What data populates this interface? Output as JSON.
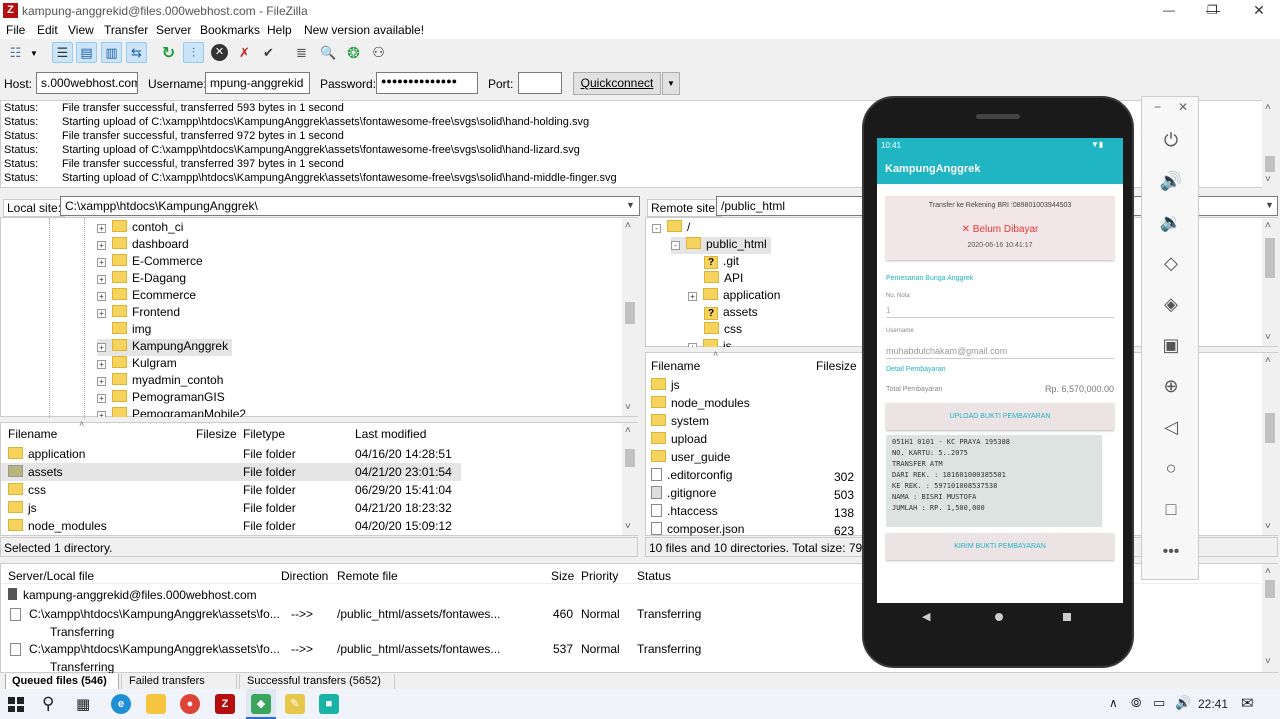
{
  "window": {
    "title": "kampung-anggrekid@files.000webhost.com - FileZilla",
    "app_icon": "Z"
  },
  "menu": [
    "File",
    "Edit",
    "View",
    "Transfer",
    "Server",
    "Bookmarks",
    "Help",
    "New version available!"
  ],
  "quickconnect": {
    "host_label": "Host:",
    "host_value": "s.000webhost.com",
    "username_label": "Username:",
    "username_value": "mpung-anggrekid",
    "password_label": "Password:",
    "password_value": "●●●●●●●●●●●●●●",
    "port_label": "Port:",
    "port_value": "",
    "button": "Quickconnect"
  },
  "log": [
    {
      "k": "Status:",
      "v": "File transfer successful, transferred 593 bytes in 1 second"
    },
    {
      "k": "Status:",
      "v": "Starting upload of C:\\xampp\\htdocs\\KampungAnggrek\\assets\\fontawesome-free\\svgs\\solid\\hand-holding.svg"
    },
    {
      "k": "Status:",
      "v": "File transfer successful, transferred 972 bytes in 1 second"
    },
    {
      "k": "Status:",
      "v": "Starting upload of C:\\xampp\\htdocs\\KampungAnggrek\\assets\\fontawesome-free\\svgs\\solid\\hand-lizard.svg"
    },
    {
      "k": "Status:",
      "v": "File transfer successful, transferred 397 bytes in 1 second"
    },
    {
      "k": "Status:",
      "v": "Starting upload of C:\\xampp\\htdocs\\KampungAnggrek\\assets\\fontawesome-free\\svgs\\solid\\hand-middle-finger.svg"
    }
  ],
  "local": {
    "site_label": "Local site:",
    "site_path": "C:\\xampp\\htdocs\\KampungAnggrek\\",
    "tree": [
      "contoh_ci",
      "dashboard",
      "E-Commerce",
      "E-Dagang",
      "Ecommerce",
      "Frontend",
      "img",
      "KampungAnggrek",
      "Kulgram",
      "myadmin_contoh",
      "PemogramanGIS",
      "PemogramanMobile2"
    ],
    "headers": {
      "name": "Filename",
      "size": "Filesize",
      "type": "Filetype",
      "modified": "Last modified"
    },
    "files": [
      {
        "name": "application",
        "type": "File folder",
        "modified": "04/16/20 14:28:51"
      },
      {
        "name": "assets",
        "type": "File folder",
        "modified": "04/21/20 23:01:54"
      },
      {
        "name": "css",
        "type": "File folder",
        "modified": "06/29/20 15:41:04"
      },
      {
        "name": "js",
        "type": "File folder",
        "modified": "04/21/20 18:23:32"
      },
      {
        "name": "node_modules",
        "type": "File folder",
        "modified": "04/20/20 15:09:12"
      }
    ],
    "status": "Selected 1 directory."
  },
  "remote": {
    "site_label": "Remote site:",
    "site_path": "/public_html",
    "tree": [
      {
        "name": "/",
        "q": false
      },
      {
        "name": "public_html",
        "q": false
      },
      {
        "name": ".git",
        "q": true
      },
      {
        "name": "API",
        "q": false
      },
      {
        "name": "application",
        "q": false
      },
      {
        "name": "assets",
        "q": true
      },
      {
        "name": "css",
        "q": false
      },
      {
        "name": "js",
        "q": false
      }
    ],
    "headers": {
      "name": "Filename",
      "size": "Filesize"
    },
    "files": [
      {
        "name": "js",
        "size": "",
        "folder": true
      },
      {
        "name": "node_modules",
        "size": "",
        "folder": true
      },
      {
        "name": "system",
        "size": "",
        "folder": true
      },
      {
        "name": "upload",
        "size": "",
        "folder": true
      },
      {
        "name": "user_guide",
        "size": "",
        "folder": true
      },
      {
        "name": ".editorconfig",
        "size": "302",
        "folder": false
      },
      {
        "name": ".gitignore",
        "size": "503",
        "folder": false
      },
      {
        "name": ".htaccess",
        "size": "138",
        "folder": false
      },
      {
        "name": "composer.json",
        "size": "623",
        "folder": false
      }
    ],
    "status": "10 files and 10 directories. Total size: 79.506 b"
  },
  "queue": {
    "headers": {
      "local": "Server/Local file",
      "dir": "Direction",
      "remote": "Remote file",
      "size": "Size",
      "priority": "Priority",
      "status": "Status"
    },
    "server": "kampung-anggrekid@files.000webhost.com",
    "rows": [
      {
        "local": "C:\\xampp\\htdocs\\KampungAnggrek\\assets\\fo...",
        "dir": "-->>",
        "remote": "/public_html/assets/fontawes...",
        "size": "460",
        "priority": "Normal",
        "status": "Transferring",
        "sub": "Transferring"
      },
      {
        "local": "C:\\xampp\\htdocs\\KampungAnggrek\\assets\\fo...",
        "dir": "-->>",
        "remote": "/public_html/assets/fontawes...",
        "size": "537",
        "priority": "Normal",
        "status": "Transferring",
        "sub": "Transferring"
      }
    ],
    "tabs": [
      "Queued files (546)",
      "Failed transfers",
      "Successful transfers (5652)"
    ]
  },
  "phone": {
    "time": "10:41",
    "app_title": "KampungAnggrek",
    "accent": "#1fb5c3",
    "card_title": "Transfer ke Rekening BRI :089801003944503",
    "card_status": "Belum Dibayar",
    "card_date": "2020-06-16 10:41:17",
    "section_order": "Pemesanan Bunga Anggrek",
    "no_nota_label": "No. Nota",
    "no_nota_value": "1",
    "username_label": "Username",
    "username_value": "muhabdulchakam@gmail.com",
    "section_payment": "Detail Pembayaran",
    "total_label": "Total Pembayaran",
    "total_value": "Rp. 6,570,000.00",
    "upload_button": "UPLOAD BUKTI PEMBAYARAN",
    "receipt_lines": [
      "051H1 0101 - KC PRAYA      195388",
      "NO. KARTU: 5..2075",
      "TRANSFER ATM",
      "DARI REK.  : 181601000385501",
      "KE REK.    : 597101008537538",
      "NAMA       : BISRI MUSTOFA",
      "JUMLAH     : RP.   1,500,000"
    ],
    "send_button": "KIRIM BUKTI PEMBAYARAN"
  },
  "taskbar": {
    "time": "22:41"
  }
}
